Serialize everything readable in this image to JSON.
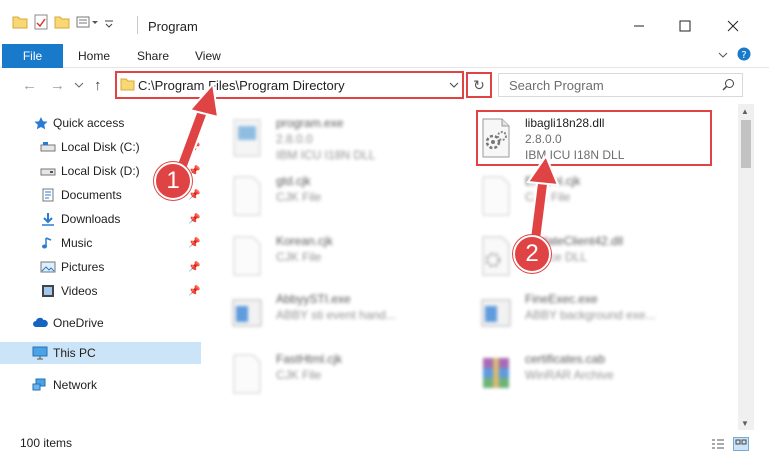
{
  "window": {
    "title": "Program",
    "minimize_icon": "minimize-icon",
    "maximize_icon": "maximize-icon",
    "close_icon": "close-icon"
  },
  "ribbon": {
    "tabs": [
      {
        "label": "File",
        "active": true
      },
      {
        "label": "Home"
      },
      {
        "label": "Share"
      },
      {
        "label": "View"
      }
    ]
  },
  "address": {
    "path": "C:\\Program Files\\Program Directory"
  },
  "search": {
    "placeholder": "Search Program"
  },
  "nav": {
    "items": [
      {
        "label": "Quick access",
        "icon": "star-icon"
      },
      {
        "label": "Local Disk (C:)",
        "icon": "drive-icon"
      },
      {
        "label": "Local Disk (D:)",
        "icon": "drive-icon"
      },
      {
        "label": "Documents",
        "icon": "documents-icon"
      },
      {
        "label": "Downloads",
        "icon": "downloads-icon"
      },
      {
        "label": "Music",
        "icon": "music-icon"
      },
      {
        "label": "Pictures",
        "icon": "pictures-icon"
      },
      {
        "label": "Videos",
        "icon": "videos-icon"
      },
      {
        "label": "OneDrive",
        "icon": "cloud-icon"
      },
      {
        "label": "This PC",
        "icon": "computer-icon",
        "selected": true
      },
      {
        "label": "Network",
        "icon": "network-icon"
      }
    ]
  },
  "files": [
    {
      "name": "program.exe",
      "version": "2.8.0.0",
      "type": "IBM ICU I18N DLL"
    },
    {
      "name": "libagli18n28.dll",
      "version": "2.8.0.0",
      "type": "IBM ICU I18N DLL"
    },
    {
      "name": "gtd.cjk",
      "type": "CJK File"
    },
    {
      "name": "Enhtml.cjk",
      "type": "CJK File"
    },
    {
      "name": "Korean.cjk",
      "type": "CJK File"
    },
    {
      "name": "UpdateClient42.dll",
      "type": "Device DLL"
    },
    {
      "name": "AbbyySTI.exe",
      "type": "ABBY sti event hand..."
    },
    {
      "name": "FineExec.exe",
      "type": "ABBY background exe..."
    },
    {
      "name": "FastHtml.cjk",
      "type": "CJK File"
    },
    {
      "name": "certificates.cab",
      "type": "WinRAR Archive"
    }
  ],
  "status": {
    "item_count": "100 items"
  },
  "annotations": {
    "step1": "1",
    "step2": "2"
  },
  "colors": {
    "accent": "#1979ca",
    "highlight": "#e04343",
    "selected": "#cce4f7"
  }
}
